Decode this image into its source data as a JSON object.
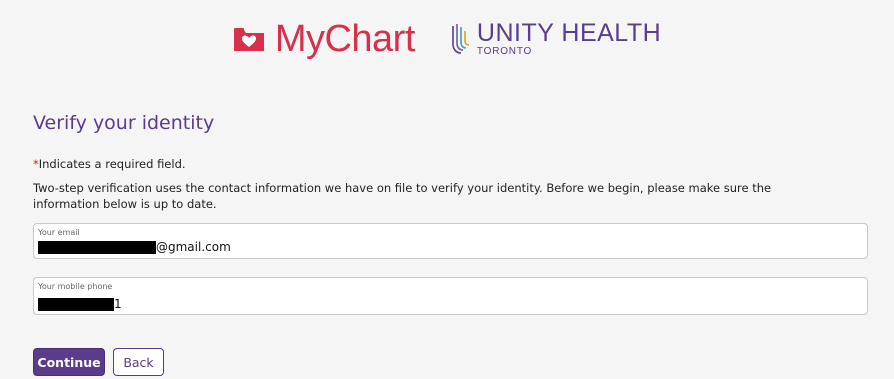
{
  "header": {
    "mychart_logo_text": "MyChart",
    "org_logo_main": "UNITY HEALTH",
    "org_logo_sub": "TORONTO",
    "mychart_color": "#d6304d",
    "org_color": "#5a3e8c"
  },
  "page": {
    "title": "Verify your identity",
    "required_star": "*",
    "required_note": "Indicates a required field.",
    "instructions": "Two-step verification uses the contact information we have on file to verify your identity. Before we begin, please make sure the information below is up to date."
  },
  "form": {
    "email": {
      "label": "Your email",
      "value_visible": "@gmail.com"
    },
    "phone": {
      "label": "Your mobile phone",
      "value_visible": "1"
    }
  },
  "buttons": {
    "continue_label": "Continue",
    "back_label": "Back"
  },
  "colors": {
    "accent": "#5b3c8a",
    "background": "#f5f5f5",
    "required": "#cc1f1f"
  },
  "icons": {
    "mychart": "mychart-folder-heart-icon",
    "unity": "unity-health-logo-icon"
  }
}
